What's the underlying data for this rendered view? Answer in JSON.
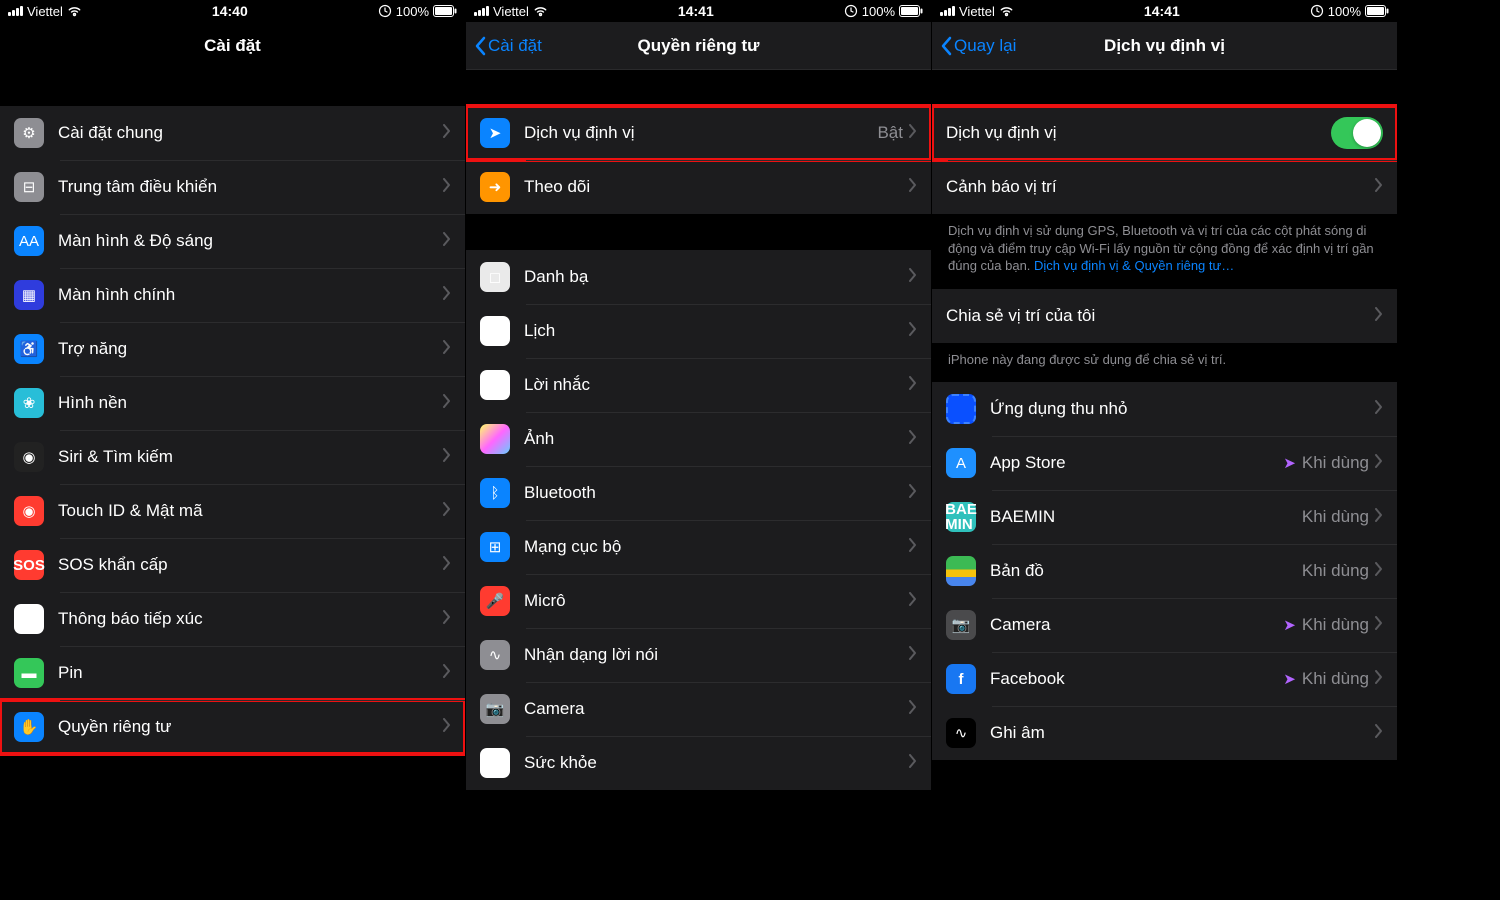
{
  "statusbar": {
    "carrier": "Viettel",
    "battery": "100%"
  },
  "times": [
    "14:40",
    "14:41",
    "14:41"
  ],
  "screen1": {
    "title": "Cài đặt",
    "items": [
      {
        "label": "Cài đặt chung",
        "iconClass": "ic-gear",
        "glyph": "⚙"
      },
      {
        "label": "Trung tâm điều khiển",
        "iconClass": "ic-control",
        "glyph": "⊟"
      },
      {
        "label": "Màn hình & Độ sáng",
        "iconClass": "ic-display",
        "glyph": "AA"
      },
      {
        "label": "Màn hình chính",
        "iconClass": "ic-home",
        "glyph": "▦"
      },
      {
        "label": "Trợ năng",
        "iconClass": "ic-access",
        "glyph": "♿"
      },
      {
        "label": "Hình nền",
        "iconClass": "ic-wall",
        "glyph": "❀"
      },
      {
        "label": "Siri & Tìm kiếm",
        "iconClass": "ic-siri",
        "glyph": "◉"
      },
      {
        "label": "Touch ID & Mật mã",
        "iconClass": "ic-touchid",
        "glyph": "◉"
      },
      {
        "label": "SOS khẩn cấp",
        "iconClass": "ic-sos",
        "glyph": "SOS"
      },
      {
        "label": "Thông báo tiếp xúc",
        "iconClass": "ic-exposure",
        "glyph": "✱"
      },
      {
        "label": "Pin",
        "iconClass": "ic-battery",
        "glyph": "▬"
      },
      {
        "label": "Quyền riêng tư",
        "iconClass": "ic-privacy",
        "glyph": "✋",
        "highlight": true
      }
    ]
  },
  "screen2": {
    "back": "Cài đặt",
    "title": "Quyền riêng tư",
    "top": [
      {
        "label": "Dịch vụ định vị",
        "value": "Bật",
        "iconClass": "ic-location",
        "glyph": "➤",
        "highlight": true
      },
      {
        "label": "Theo dõi",
        "iconClass": "ic-tracking",
        "glyph": "➜"
      }
    ],
    "items": [
      {
        "label": "Danh bạ",
        "iconClass": "ic-contacts",
        "glyph": "◻"
      },
      {
        "label": "Lịch",
        "iconClass": "ic-calendar",
        "glyph": "▦"
      },
      {
        "label": "Lời nhắc",
        "iconClass": "ic-reminders",
        "glyph": "☰"
      },
      {
        "label": "Ảnh",
        "iconClass": "ic-photos",
        "glyph": ""
      },
      {
        "label": "Bluetooth",
        "iconClass": "ic-bt",
        "glyph": "ᛒ"
      },
      {
        "label": "Mạng cục bộ",
        "iconClass": "ic-lan",
        "glyph": "⊞"
      },
      {
        "label": "Micrô",
        "iconClass": "ic-mic",
        "glyph": "🎤"
      },
      {
        "label": "Nhận dạng lời nói",
        "iconClass": "ic-speech",
        "glyph": "∿"
      },
      {
        "label": "Camera",
        "iconClass": "ic-camera",
        "glyph": "📷"
      },
      {
        "label": "Sức khỏe",
        "iconClass": "ic-health",
        "glyph": "♥"
      }
    ]
  },
  "screen3": {
    "back": "Quay lại",
    "title": "Dịch vụ định vị",
    "toggleRow": {
      "label": "Dịch vụ định vị",
      "highlight": true
    },
    "alertsRow": {
      "label": "Cảnh báo vị trí"
    },
    "footer": "Dịch vụ định vị sử dụng GPS, Bluetooth và vị trí của các cột phát sóng di động và điểm truy cập Wi-Fi lấy nguồn từ cộng đồng để xác định vị trí gần đúng của bạn. ",
    "footerLink": "Dịch vụ định vị & Quyền riêng tư…",
    "shareRow": {
      "label": "Chia sẻ vị trí của tôi"
    },
    "shareFooter": "iPhone này đang được sử dụng để chia sẻ vị trí.",
    "apps": [
      {
        "label": "Ứng dụng thu nhỏ",
        "iconClass": "ic-clips",
        "glyph": ""
      },
      {
        "label": "App Store",
        "value": "Khi dùng",
        "iconClass": "ic-appstore",
        "glyph": "A",
        "arrow": "filled"
      },
      {
        "label": "BAEMIN",
        "value": "Khi dùng",
        "iconClass": "ic-baemin",
        "glyph": "BAE\nMIN"
      },
      {
        "label": "Bản đồ",
        "value": "Khi dùng",
        "iconClass": "ic-maps",
        "glyph": ""
      },
      {
        "label": "Camera",
        "value": "Khi dùng",
        "iconClass": "ic-cam2",
        "glyph": "📷",
        "arrow": "filled"
      },
      {
        "label": "Facebook",
        "value": "Khi dùng",
        "iconClass": "ic-fb",
        "glyph": "f",
        "arrow": "filled"
      },
      {
        "label": "Ghi âm",
        "iconClass": "ic-record",
        "glyph": "∿"
      }
    ]
  }
}
